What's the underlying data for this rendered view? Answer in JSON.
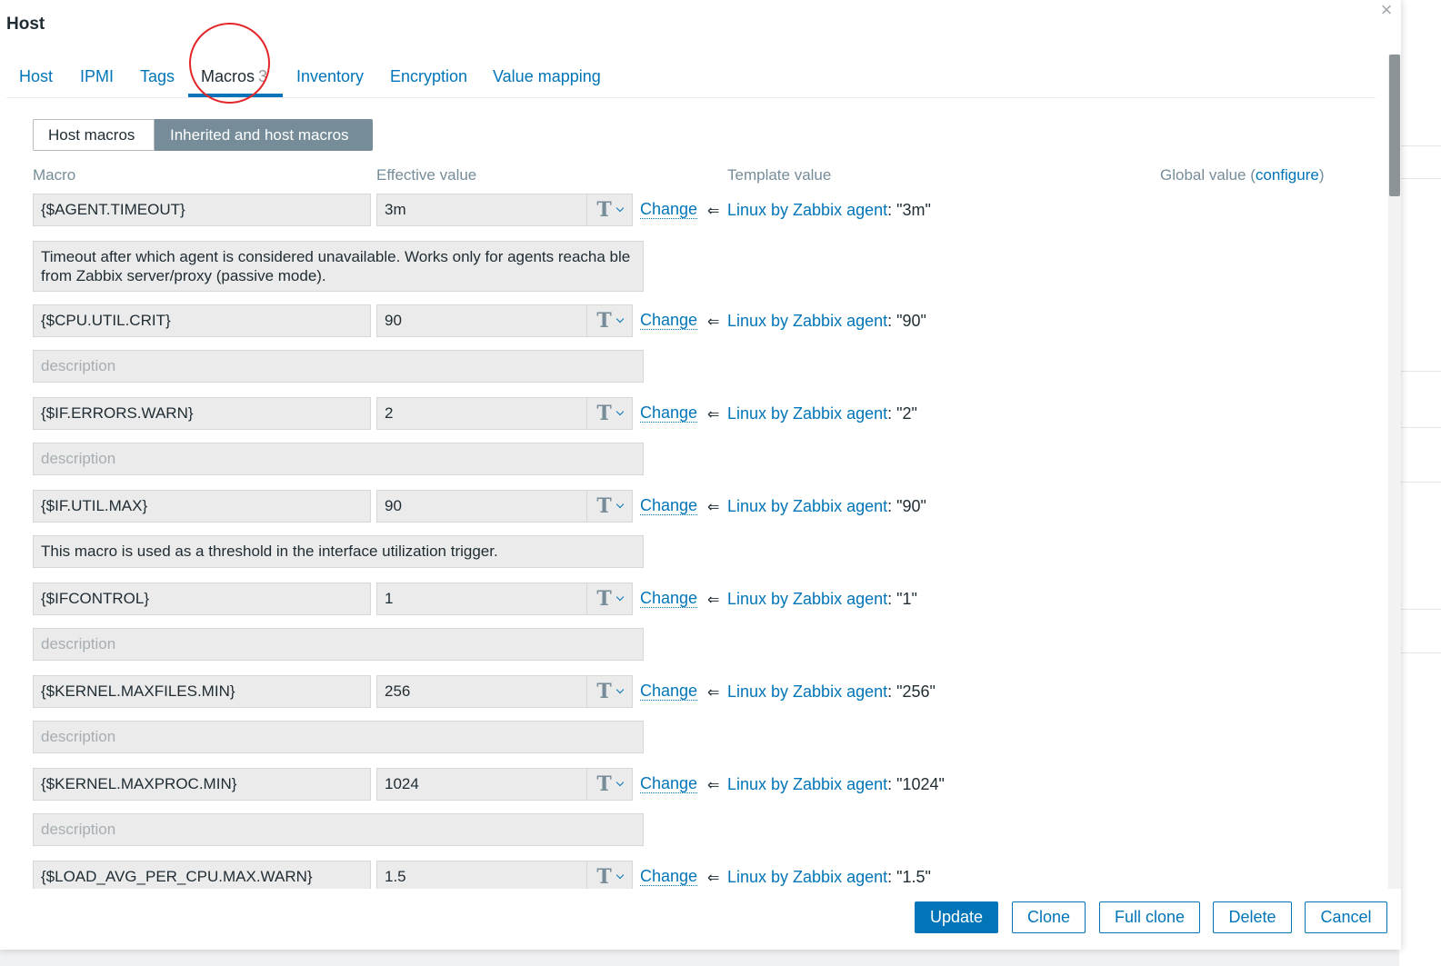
{
  "dialog": {
    "title": "Host",
    "close_icon": "×"
  },
  "tabs": [
    {
      "label": "Host"
    },
    {
      "label": "IPMI"
    },
    {
      "label": "Tags"
    },
    {
      "label": "Macros",
      "count": "3",
      "active": true
    },
    {
      "label": "Inventory"
    },
    {
      "label": "Encryption"
    },
    {
      "label": "Value mapping"
    }
  ],
  "macro_mode": {
    "host_macros": "Host macros",
    "inherited": "Inherited and host macros",
    "selected": "Inherited and host macros"
  },
  "headers": {
    "macro": "Macro",
    "effective_value": "Effective value",
    "template_value": "Template value",
    "global_value": "Global value (",
    "configure": "configure",
    "global_close": ")"
  },
  "change_label": "Change",
  "arrow": "⇐",
  "macros": [
    {
      "name": "{$AGENT.TIMEOUT}",
      "value": "3m",
      "template": "Linux by Zabbix agent",
      "template_value": ": \"3m\"",
      "description": "Timeout after which agent is considered unavailable. Works only for agents reacha ble from Zabbix server/proxy (passive mode)."
    },
    {
      "name": "{$CPU.UTIL.CRIT}",
      "value": "90",
      "template": "Linux by Zabbix agent",
      "template_value": ": \"90\"",
      "description": "description"
    },
    {
      "name": "{$IF.ERRORS.WARN}",
      "value": "2",
      "template": "Linux by Zabbix agent",
      "template_value": ": \"2\"",
      "description": "description"
    },
    {
      "name": "{$IF.UTIL.MAX}",
      "value": "90",
      "template": "Linux by Zabbix agent",
      "template_value": ": \"90\"",
      "description": "This macro is used as a threshold in the interface utilization trigger."
    },
    {
      "name": "{$IFCONTROL}",
      "value": "1",
      "template": "Linux by Zabbix agent",
      "template_value": ": \"1\"",
      "description": "description"
    },
    {
      "name": "{$KERNEL.MAXFILES.MIN}",
      "value": "256",
      "template": "Linux by Zabbix agent",
      "template_value": ": \"256\"",
      "description": "description"
    },
    {
      "name": "{$KERNEL.MAXPROC.MIN}",
      "value": "1024",
      "template": "Linux by Zabbix agent",
      "template_value": ": \"1024\"",
      "description": "description"
    },
    {
      "name": "{$LOAD_AVG_PER_CPU.MAX.WARN}",
      "value": "1.5",
      "template": "Linux by Zabbix agent",
      "template_value": ": \"1.5\""
    }
  ],
  "footer": {
    "update": "Update",
    "clone": "Clone",
    "full_clone": "Full clone",
    "delete": "Delete",
    "cancel": "Cancel"
  },
  "colors": {
    "accent": "#0275b8",
    "annotation": "#e3262a",
    "segment_active": "#768d99"
  }
}
